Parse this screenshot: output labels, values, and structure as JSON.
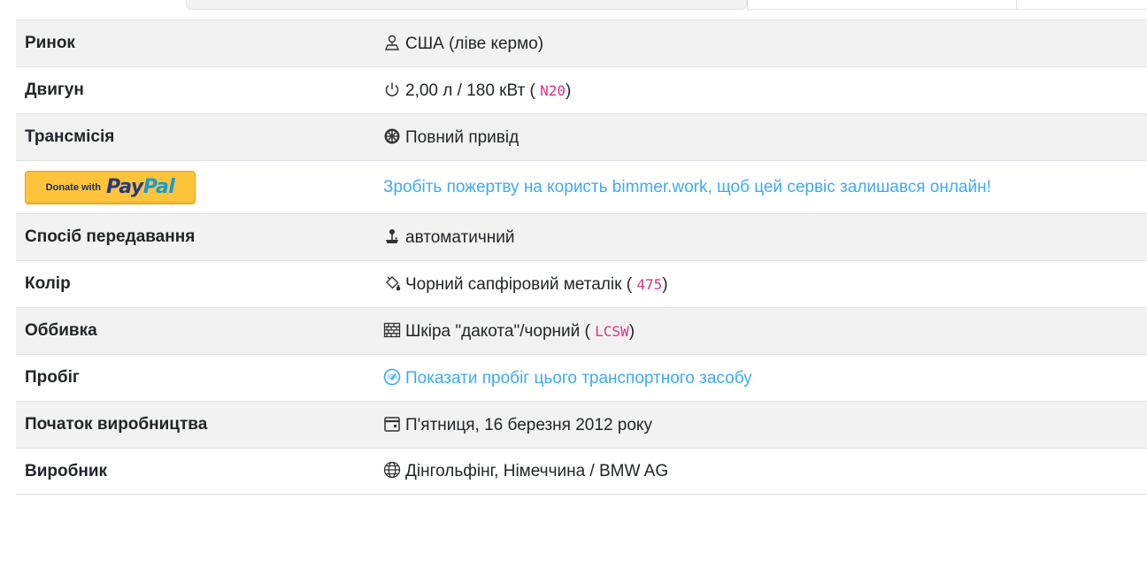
{
  "paypal": {
    "small_text": "Donate with",
    "logo_part1": "Pay",
    "logo_part2": "Pal",
    "message": "Зробіть пожертву на користь bimmer.work, щоб цей сервіс залишався онлайн!"
  },
  "rows": {
    "market": {
      "label": "Ринок",
      "value": "США (ліве кермо)",
      "icon": "person-map-icon"
    },
    "engine": {
      "label": "Двигун",
      "value_prefix": "2,00 л / 180 кВт (",
      "code": "N20",
      "value_suffix": ")",
      "icon": "power-icon"
    },
    "transmission": {
      "label": "Трансмісія",
      "value": "Повний привід",
      "icon": "wheel-icon"
    },
    "gearbox": {
      "label": "Спосіб передавання",
      "value": "автоматичний",
      "icon": "joystick-icon"
    },
    "color": {
      "label": "Колір",
      "value_prefix": "Чорний сапфіровий металік (",
      "code": "475",
      "value_suffix": ")",
      "icon": "paint-bucket-icon"
    },
    "upholstery": {
      "label": "Оббивка",
      "value_prefix": "Шкіра \"дакота\"/чорний (",
      "code": "LCSW",
      "value_suffix": ")",
      "icon": "grid-icon"
    },
    "mileage": {
      "label": "Пробіг",
      "value": "Показати пробіг цього транспортного засобу",
      "icon": "speedometer-icon"
    },
    "production_start": {
      "label": "Початок виробництва",
      "value": "П'ятниця, 16 березня 2012 року",
      "icon": "calendar-icon"
    },
    "manufacturer": {
      "label": "Виробник",
      "value": "Дінгольфінг, Німеччина / BMW AG",
      "icon": "globe-icon"
    }
  },
  "colors": {
    "link": "#3fa9f5",
    "code": "#d63384",
    "row_stripe": "#f2f2f2",
    "paypal_yellow": "#ffc439"
  }
}
